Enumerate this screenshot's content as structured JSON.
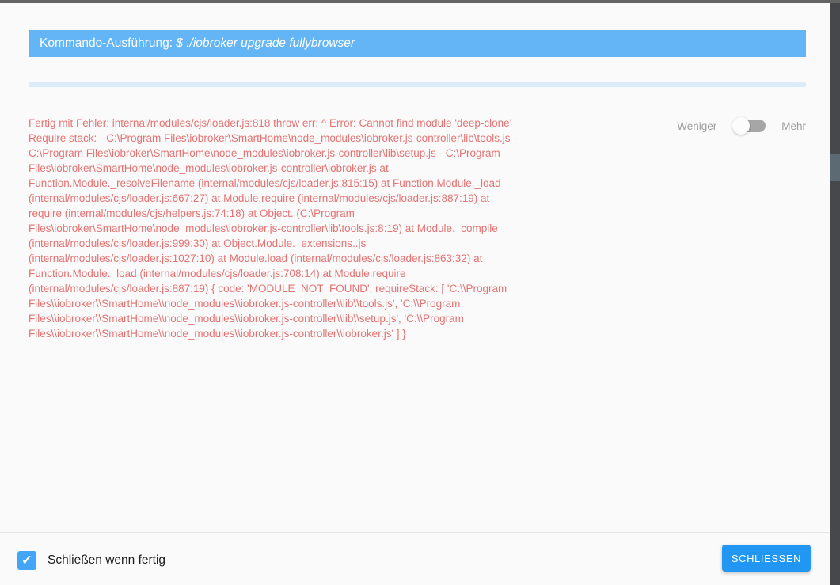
{
  "dialog": {
    "header": {
      "title_prefix": "Kommando-Ausführung: ",
      "command": "$ ./iobroker upgrade fullybrowser"
    },
    "log": {
      "text": "Fertig mit Fehler: internal/modules/cjs/loader.js:818 throw err; ^ Error: Cannot find module 'deep-clone'\nRequire stack: - C:\\Program Files\\iobroker\\SmartHome\\node_modules\\iobroker.js-controller\\lib\\tools.js -\nC:\\Program Files\\iobroker\\SmartHome\\node_modules\\iobroker.js-controller\\lib\\setup.js - C:\\Program\nFiles\\iobroker\\SmartHome\\node_modules\\iobroker.js-controller\\iobroker.js at\nFunction.Module._resolveFilename (internal/modules/cjs/loader.js:815:15) at Function.Module._load\n(internal/modules/cjs/loader.js:667:27) at Module.require (internal/modules/cjs/loader.js:887:19) at\nrequire (internal/modules/cjs/helpers.js:74:18) at Object. (C:\\Program\nFiles\\iobroker\\SmartHome\\node_modules\\iobroker.js-controller\\lib\\tools.js:8:19) at Module._compile\n(internal/modules/cjs/loader.js:999:30) at Object.Module._extensions..js\n(internal/modules/cjs/loader.js:1027:10) at Module.load (internal/modules/cjs/loader.js:863:32) at\nFunction.Module._load (internal/modules/cjs/loader.js:708:14) at Module.require\n(internal/modules/cjs/loader.js:887:19) { code: 'MODULE_NOT_FOUND', requireStack: [ 'C:\\\\Program\nFiles\\\\iobroker\\\\SmartHome\\\\node_modules\\\\iobroker.js-controller\\\\lib\\\\tools.js', 'C:\\\\Program\nFiles\\\\iobroker\\\\SmartHome\\\\node_modules\\\\iobroker.js-controller\\\\lib\\\\setup.js', 'C:\\\\Program\nFiles\\\\iobroker\\\\SmartHome\\\\node_modules\\\\iobroker.js-controller\\\\iobroker.js' ] }"
    },
    "detail_toggle": {
      "less_label": "Weniger",
      "more_label": "Mehr",
      "state": "less"
    },
    "footer": {
      "checkbox_label": "Schließen wenn fertig",
      "checkbox_checked": true,
      "checkbox_check_glyph": "✓",
      "close_button_label": "SCHLIESSEN"
    }
  },
  "colors": {
    "header_bg": "#64b5f6",
    "progress_track": "#dcebf8",
    "error_text": "#e57373",
    "toggle_label": "#9e9e9e",
    "checkbox_bg": "#42a5f5",
    "button_bg": "#2196f3",
    "dialog_bg": "#fafafa",
    "top_strip": "#646464",
    "right_strip": "#46484c"
  }
}
